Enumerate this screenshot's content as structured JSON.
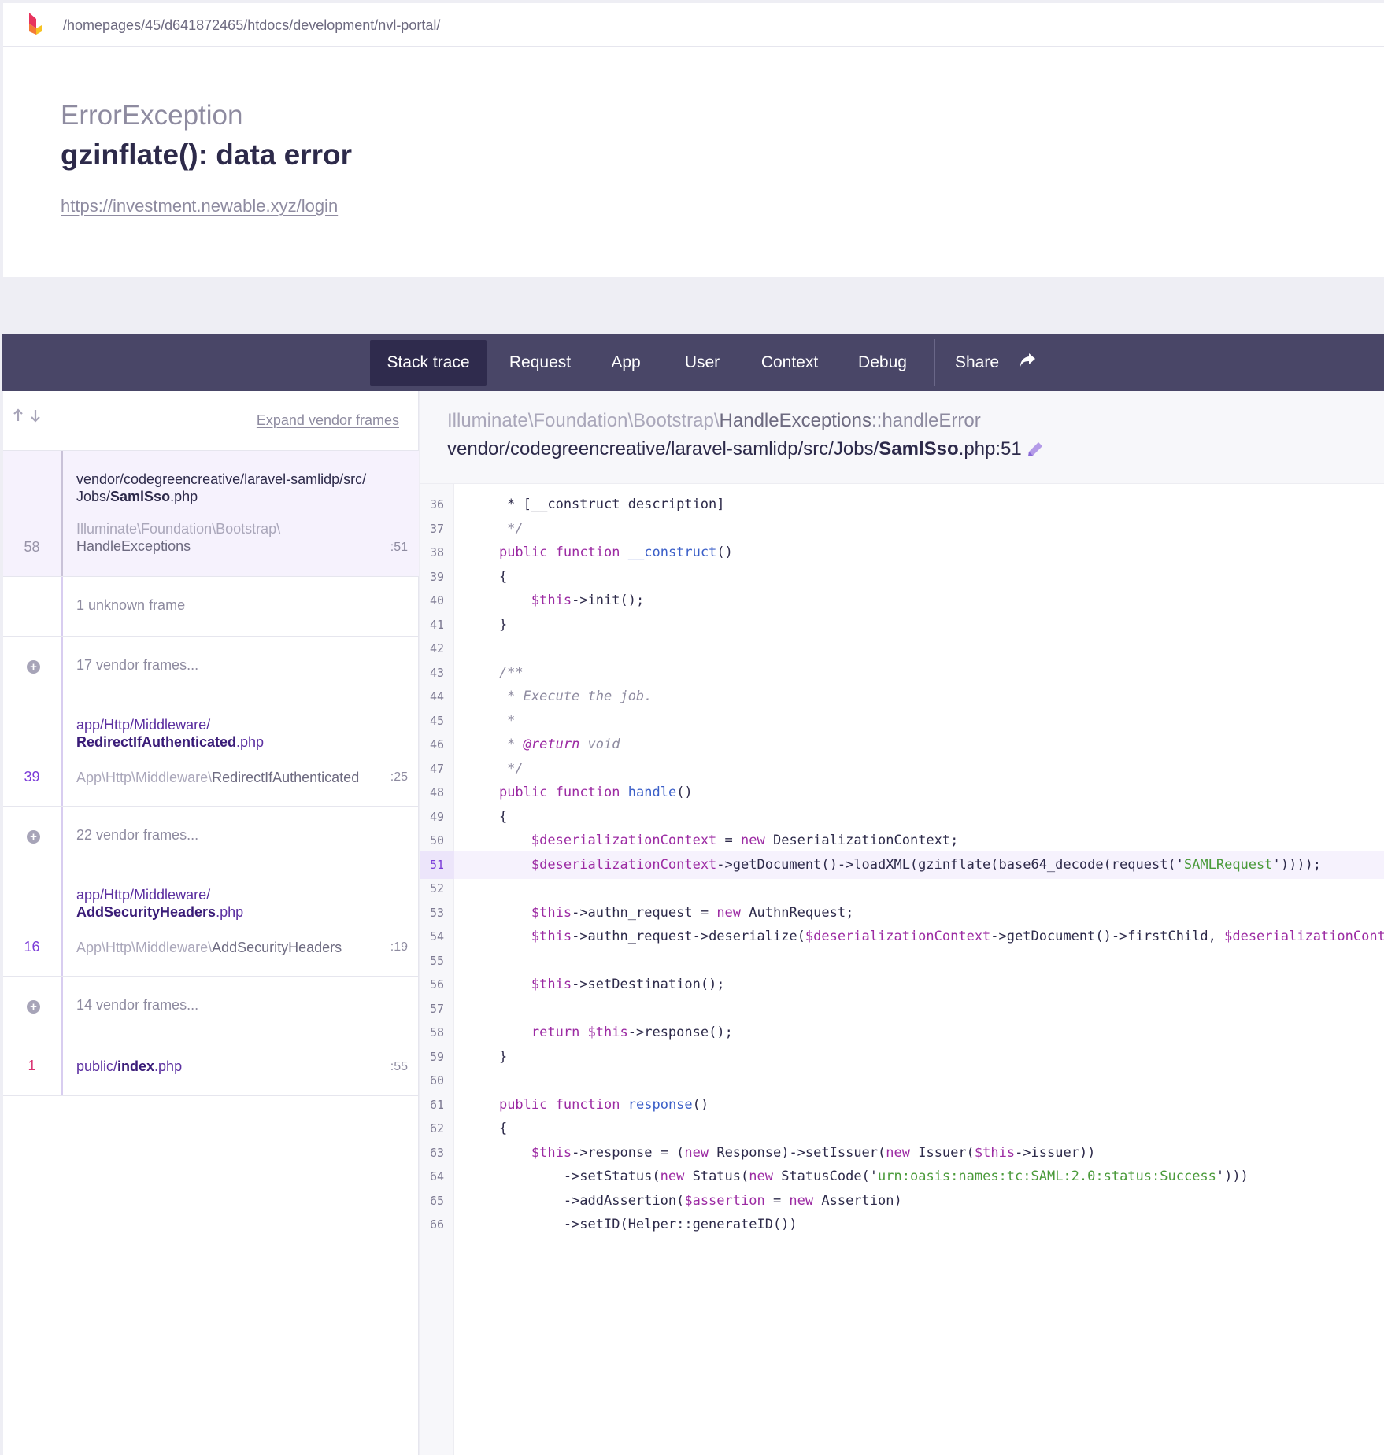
{
  "topbar": {
    "path": "/homepages/45/d641872465/htdocs/development/nvl-portal/"
  },
  "header": {
    "exception_class": "ErrorException",
    "message": "gzinflate(): data error",
    "url": "https://investment.newable.xyz/login"
  },
  "nav": {
    "tabs": [
      "Stack trace",
      "Request",
      "App",
      "User",
      "Context",
      "Debug",
      "Share"
    ],
    "active": "Stack trace"
  },
  "left": {
    "expand_vendor": "Expand vendor frames",
    "frames": [
      {
        "num": "58",
        "path_dir": "vendor/codegreencreative/laravel-samlidp/src/",
        "path_dir2": "Jobs/",
        "path_file": "SamlSso",
        "path_ext": ".php",
        "class_ns": "Illuminate\\Foundation\\Bootstrap\\",
        "class_name": "HandleExceptions",
        "line": ":51"
      },
      {
        "label": "1 unknown frame"
      },
      {
        "label": "17 vendor frames..."
      },
      {
        "num": "39",
        "path_dir": "app/Http/Middleware/",
        "path_file": "RedirectIfAuthenticated",
        "path_ext": ".php",
        "class_ns": "App\\Http\\Middleware\\",
        "class_name": "RedirectIfAuthenticated",
        "line": ":25"
      },
      {
        "label": "22 vendor frames..."
      },
      {
        "num": "16",
        "path_dir": "app/Http/Middleware/",
        "path_file": "AddSecurityHeaders",
        "path_ext": ".php",
        "class_ns": "App\\Http\\Middleware\\",
        "class_name": "AddSecurityHeaders",
        "line": ":19"
      },
      {
        "label": "14 vendor frames..."
      },
      {
        "num": "1",
        "path_dir": "public/",
        "path_file": "index",
        "path_ext": ".php",
        "line": ":55"
      }
    ]
  },
  "right": {
    "class_ns": "Illuminate\\Foundation\\Bootstrap\\",
    "class_name": "HandleExceptions",
    "method": "::handleError",
    "file_dir": "vendor/codegreencreative/laravel-samlidp/src/Jobs/",
    "file_name": "SamlSso",
    "file_ext": ".php:51",
    "highlight_line": 51,
    "code_lines": [
      {
        "n": "36",
        "t": "     * [__construct description]"
      },
      {
        "n": "37",
        "t": "     */"
      },
      {
        "n": "38",
        "t": "    public function __construct()"
      },
      {
        "n": "39",
        "t": "    {"
      },
      {
        "n": "40",
        "t": "        $this->init();"
      },
      {
        "n": "41",
        "t": "    }"
      },
      {
        "n": "42",
        "t": ""
      },
      {
        "n": "43",
        "t": "    /**"
      },
      {
        "n": "44",
        "t": "     * Execute the job."
      },
      {
        "n": "45",
        "t": "     *"
      },
      {
        "n": "46",
        "t": "     * @return void"
      },
      {
        "n": "47",
        "t": "     */"
      },
      {
        "n": "48",
        "t": "    public function handle()"
      },
      {
        "n": "49",
        "t": "    {"
      },
      {
        "n": "50",
        "t": "        $deserializationContext = new DeserializationContext;"
      },
      {
        "n": "51",
        "t": "        $deserializationContext->getDocument()->loadXML(gzinflate(base64_decode(request('SAMLRequest'))));"
      },
      {
        "n": "52",
        "t": ""
      },
      {
        "n": "53",
        "t": "        $this->authn_request = new AuthnRequest;"
      },
      {
        "n": "54",
        "t": "        $this->authn_request->deserialize($deserializationContext->getDocument()->firstChild, $deserializationContex"
      },
      {
        "n": "55",
        "t": ""
      },
      {
        "n": "56",
        "t": "        $this->setDestination();"
      },
      {
        "n": "57",
        "t": ""
      },
      {
        "n": "58",
        "t": "        return $this->response();"
      },
      {
        "n": "59",
        "t": "    }"
      },
      {
        "n": "60",
        "t": ""
      },
      {
        "n": "61",
        "t": "    public function response()"
      },
      {
        "n": "62",
        "t": "    {"
      },
      {
        "n": "63",
        "t": "        $this->response = (new Response)->setIssuer(new Issuer($this->issuer))"
      },
      {
        "n": "64",
        "t": "            ->setStatus(new Status(new StatusCode('urn:oasis:names:tc:SAML:2.0:status:Success')))"
      },
      {
        "n": "65",
        "t": "            ->addAssertion($assertion = new Assertion)"
      },
      {
        "n": "66",
        "t": "            ->setID(Helper::generateID())"
      }
    ]
  },
  "colors": {
    "nav_bg": "#494667",
    "nav_active": "#2f2b4d",
    "accent": "#7b3cd8"
  },
  "icons": [
    "ignition-logo",
    "share-icon",
    "arrow-up-icon",
    "arrow-down-icon",
    "plus-circle-icon",
    "pencil-icon"
  ]
}
